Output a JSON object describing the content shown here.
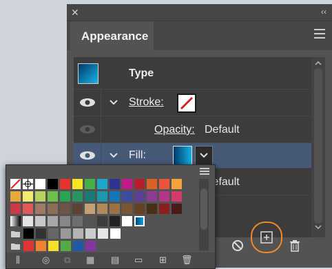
{
  "panel": {
    "title": "Appearance",
    "rows": [
      {
        "label": "Type"
      },
      {
        "label": "Stroke:"
      },
      {
        "label": "Opacity:",
        "value": "Default"
      },
      {
        "label": "Fill:"
      },
      {
        "value": "Default"
      }
    ],
    "footer_buttons": [
      "clear-appearance",
      "add-new-effect",
      "delete-item"
    ]
  },
  "swatches": {
    "colors": [
      [
        "#ffffff",
        "#ffffff",
        "#ffffff",
        "#000000",
        "#e8332d",
        "#f5e626",
        "#43b049",
        "#1da7c9",
        "#2e3392",
        "#c21a8a",
        "#b71e2b",
        "#da6226",
        "#ea5637",
        "#f4a23a"
      ],
      [
        "#e8a83b",
        "#f2eb73",
        "#b6d25f",
        "#6fbf4b",
        "#2aa453",
        "#2a9460",
        "#1a7a78",
        "#1b99b0",
        "#1276b9",
        "#3c4da0",
        "#5d3f95",
        "#8c3d93",
        "#b4368a",
        "#d63a6a"
      ],
      [
        "#cb3b45",
        "#e05a5a",
        "#a07a67",
        "#8b6d58",
        "#705448",
        "#5b4236",
        "#c4a075",
        "#b08a5b",
        "#997245",
        "#7a5632",
        "#654223",
        "#4a2f17",
        "#8c1e1e",
        "#4b1a1a"
      ],
      [
        "#1a8ec4",
        "#e4e4e4",
        "#c8c8c8",
        "#a8a8a8",
        "#888888",
        "#6e6e6e",
        "#555555",
        "#3c3c3c",
        "#232323",
        "#ffffff",
        "#000000"
      ],
      [
        "#000000",
        "#333333",
        "#666666",
        "#999999",
        "#b3b3b3",
        "#cccccc",
        "#e6e6e6",
        "#ffffff"
      ],
      [
        "#e03530",
        "#f08232",
        "#f5df2b",
        "#52ac43",
        "#1e5aaa",
        "#8436a0"
      ]
    ]
  }
}
